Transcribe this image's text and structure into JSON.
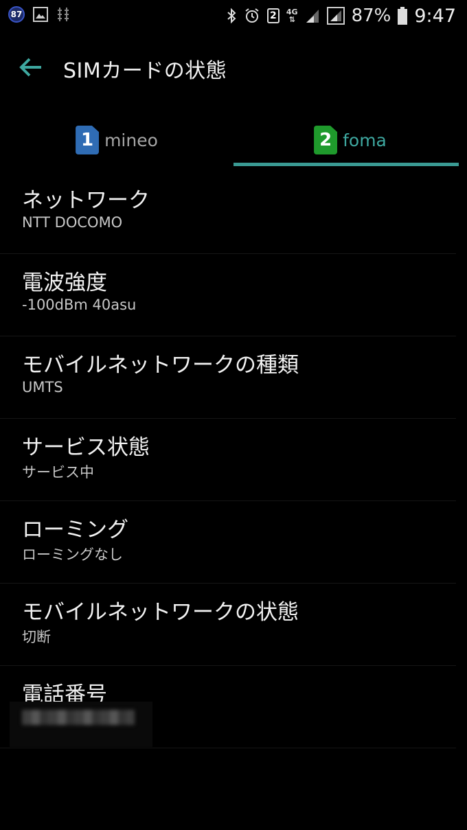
{
  "status_bar": {
    "notification_count": "87",
    "sim2_label": "2",
    "network_type_top": "4G",
    "battery_percent": "87%",
    "time": "9:47",
    "icons": [
      "gallery-icon",
      "usb-debug-icon",
      "bluetooth-icon",
      "alarm-icon",
      "sim2-icon",
      "signal-icon",
      "signal-icon",
      "battery-icon"
    ]
  },
  "app_bar": {
    "title": "SIMカードの状態",
    "back_icon": "arrow-left-icon"
  },
  "tabs": [
    {
      "number": "1",
      "label": "mineo",
      "selected": false,
      "color": "#2f6cb4"
    },
    {
      "number": "2",
      "label": "foma",
      "selected": true,
      "color": "#1f9a2c"
    }
  ],
  "accent_color": "#3a9a93",
  "items": [
    {
      "title": "ネットワーク",
      "value": "NTT DOCOMO"
    },
    {
      "title": "電波強度",
      "value": "-100dBm 40asu"
    },
    {
      "title": "モバイルネットワークの種類",
      "value": "UMTS"
    },
    {
      "title": "サービス状態",
      "value": "サービス中"
    },
    {
      "title": "ローミング",
      "value": "ローミングなし"
    },
    {
      "title": "モバイルネットワークの状態",
      "value": "切断"
    },
    {
      "title": "電話番号",
      "value": ""
    }
  ]
}
